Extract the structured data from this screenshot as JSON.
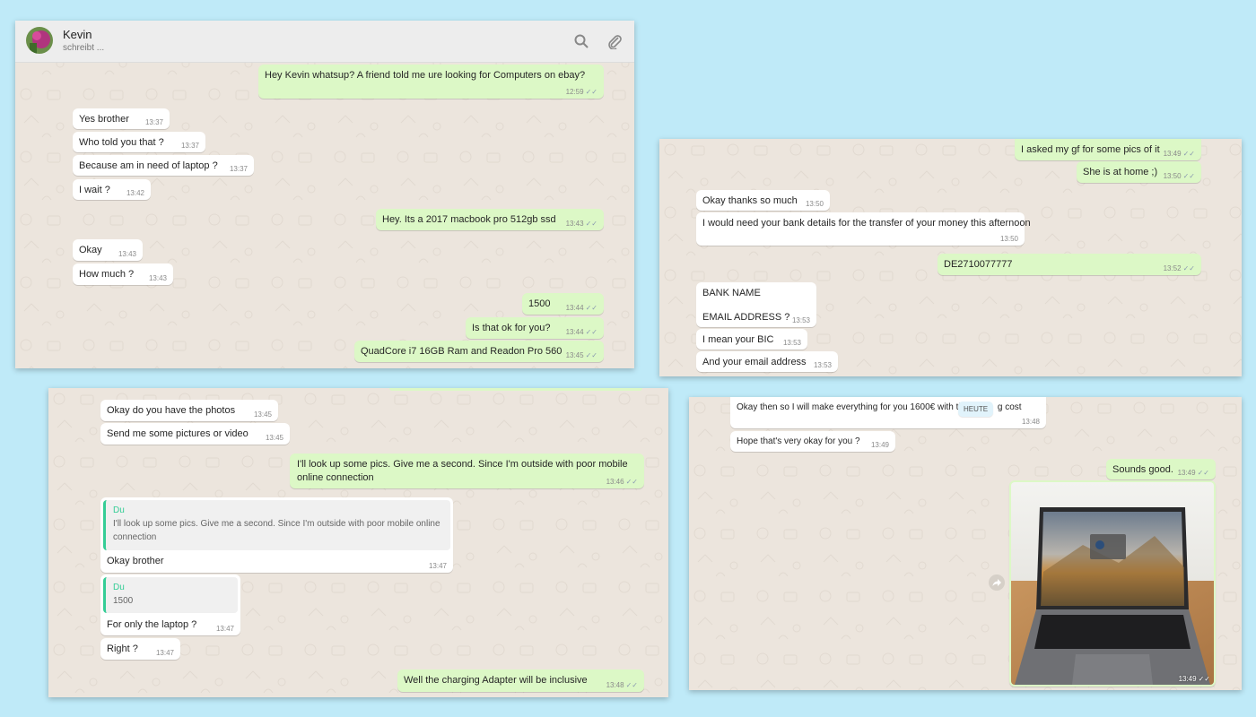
{
  "colors": {
    "background": "#bfeaf8",
    "chat_bg": "#ece5dd",
    "incoming": "#ffffff",
    "outgoing": "#dcf8c6",
    "quote_accent": "#35cd96"
  },
  "panel1": {
    "contact_name": "Kevin",
    "contact_status": "schreibt ...",
    "icons": [
      "search-icon",
      "paperclip-icon"
    ],
    "messages": [
      {
        "text": "Hey Kevin whatsup? A friend told me ure looking for Computers on ebay?",
        "time": "12:59"
      },
      {
        "text": "Yes brother",
        "time": "13:37"
      },
      {
        "text": "Who told you that ?",
        "time": "13:37"
      },
      {
        "text": "Because am in need of laptop ?",
        "time": "13:37"
      },
      {
        "text": "I wait ?",
        "time": "13:42"
      },
      {
        "text": "Hey. Its a 2017 macbook pro 512gb ssd",
        "time": "13:43"
      },
      {
        "text": "Okay",
        "time": "13:43"
      },
      {
        "text": "How much ?",
        "time": "13:43"
      },
      {
        "text": "1500",
        "time": "13:44"
      },
      {
        "text": "Is that ok for you?",
        "time": "13:44"
      },
      {
        "text": "QuadCore i7 16GB Ram and Readon Pro 560",
        "time": "13:45"
      }
    ]
  },
  "panel2": {
    "messages": [
      {
        "text": "I asked my gf for some pics of it",
        "time": "13:49"
      },
      {
        "text": "She is at home ;)",
        "time": "13:50"
      },
      {
        "text": "Okay thanks so much",
        "time": "13:50"
      },
      {
        "text": "I would need your bank details for the transfer of your money this afternoon",
        "time": "13:50"
      },
      {
        "text": "DE2710077777",
        "time": "13:52"
      },
      {
        "text": "BANK NAME",
        "text2": "EMAIL ADDRESS ?",
        "time": "13:53"
      },
      {
        "text": "I mean your BIC",
        "time": "13:53"
      },
      {
        "text": "And your email address",
        "time": "13:53"
      }
    ]
  },
  "panel3": {
    "messages": [
      {
        "text": "Okay do you have the photos",
        "time": "13:45"
      },
      {
        "text": "Send me some pictures or video",
        "time": "13:45"
      },
      {
        "text": "I'll look up some pics. Give me a second. Since I'm outside with poor mobile",
        "text2": "online connection",
        "time": "13:46"
      },
      {
        "quote_name": "Du",
        "quote_text": "I'll look up some pics. Give me a second. Since I'm outside with poor mobile online connection",
        "text": "Okay brother",
        "time": "13:47"
      },
      {
        "quote_name": "Du",
        "quote_text": "1500",
        "text": "For only the laptop ?",
        "time": "13:47"
      },
      {
        "text": "Right ?",
        "time": "13:47"
      },
      {
        "text": "Well the charging Adapter will be inclusive",
        "time": "13:48"
      }
    ]
  },
  "panel4": {
    "messages": [
      {
        "text_a": "Okay then so I will make everything for you 1600€ with th",
        "text_b": "g cost",
        "time": "13:48"
      },
      {
        "text": "Hope that's very okay for you ?",
        "time": "13:49"
      },
      {
        "text": "Sounds good.",
        "time": "13:49"
      },
      {
        "image": "laptop-photo",
        "time": "13:49"
      }
    ],
    "date_badge": "HEUTE",
    "forward_icon": "forward-icon"
  }
}
